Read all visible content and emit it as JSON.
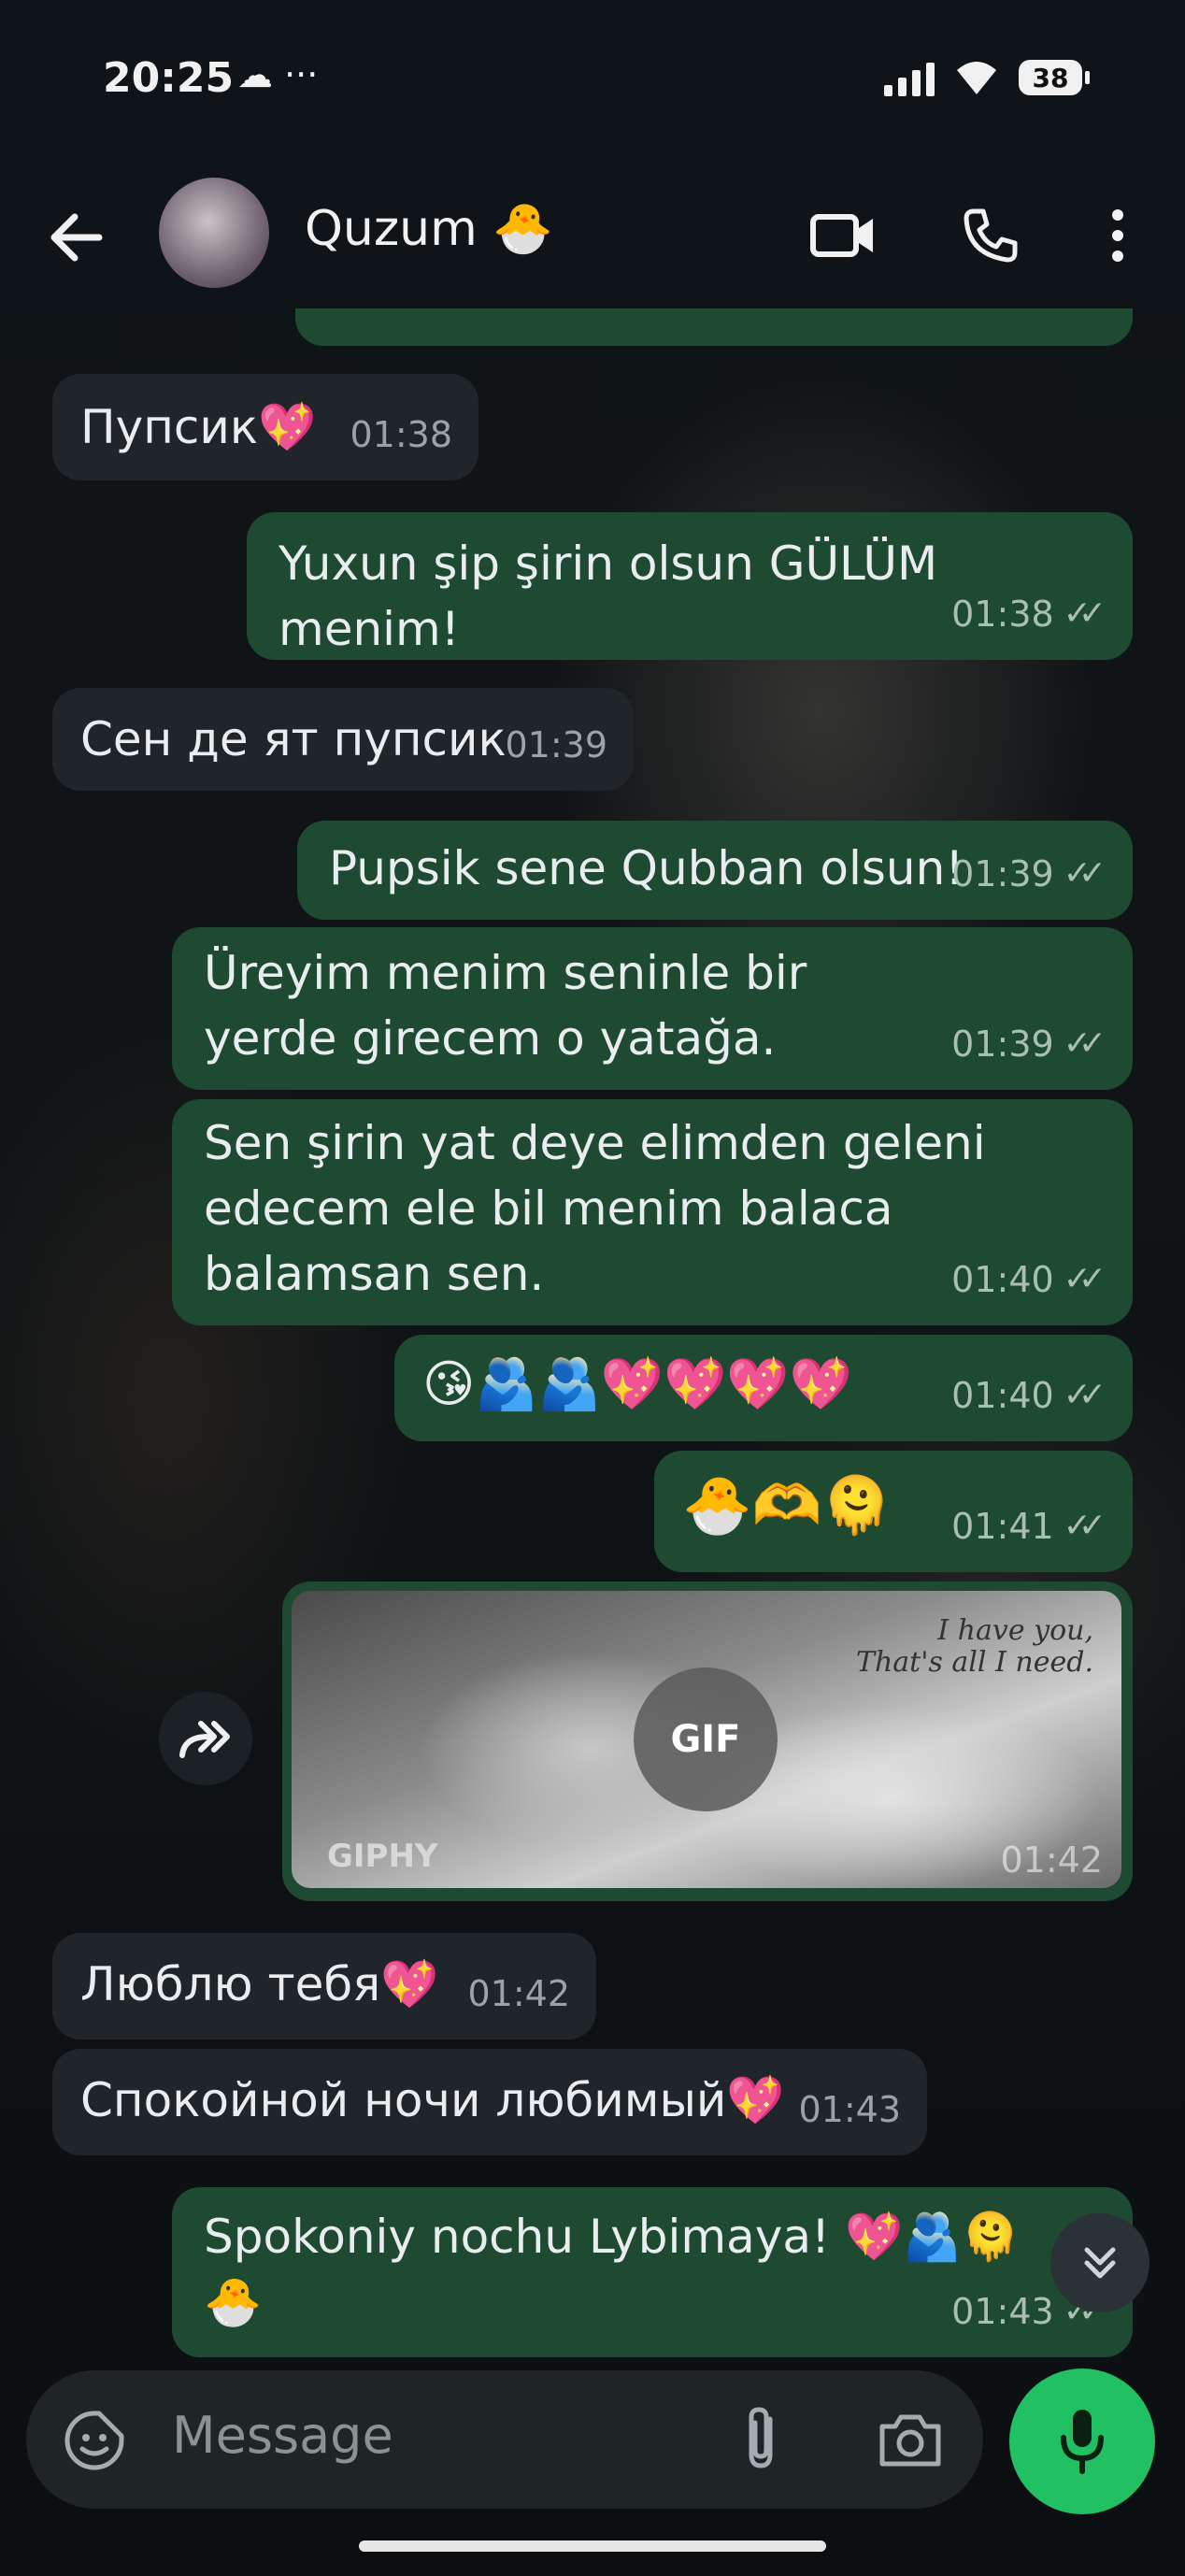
{
  "status_bar": {
    "time": "20:25",
    "left_icons": "☁ ···",
    "battery": "38"
  },
  "header": {
    "contact_name": "Quzum 🐣"
  },
  "messages": [
    {
      "text": "Пупсик💖",
      "time": "01:38",
      "dir": "in"
    },
    {
      "text": "Yuxun şip şirin olsun GÜLÜM menim!",
      "time": "01:38",
      "dir": "out"
    },
    {
      "text": "Сен де ят пупсик",
      "time": "01:39",
      "dir": "in"
    },
    {
      "text": "Pupsik sene Qubban olsun!",
      "time": "01:39",
      "dir": "out"
    },
    {
      "text": "Üreyim menim seninle bir yerde girecem o yatağa.",
      "time": "01:39",
      "dir": "out"
    },
    {
      "text": "Sen şirin yat deye elimden geleni edecem ele bil menim balaca balamsan sen.",
      "time": "01:40",
      "dir": "out"
    },
    {
      "text": "😘🫂🫂💖💖💖💖",
      "time": "01:40",
      "dir": "out"
    },
    {
      "text": "🐣🫶🫠",
      "time": "01:41",
      "dir": "out"
    },
    {
      "text": "Люблю тебя💖",
      "time": "01:42",
      "dir": "in"
    },
    {
      "text": "Спокойной ночи любимый💖",
      "time": "01:43",
      "dir": "in"
    },
    {
      "text": "Spokoniy nochu Lybimaya! 💖🫂🫠 🐣",
      "time": "01:43",
      "dir": "out"
    }
  ],
  "gif": {
    "badge": "GIF",
    "provider": "GIPHY",
    "caption_line1": "I have you,",
    "caption_line2": "That's all I need.",
    "time": "01:42"
  },
  "composer": {
    "placeholder": "Message"
  },
  "colors": {
    "outgoing_bubble": "#1d4a30",
    "incoming_bubble": "#1f2529",
    "mic_button": "#21c063"
  }
}
